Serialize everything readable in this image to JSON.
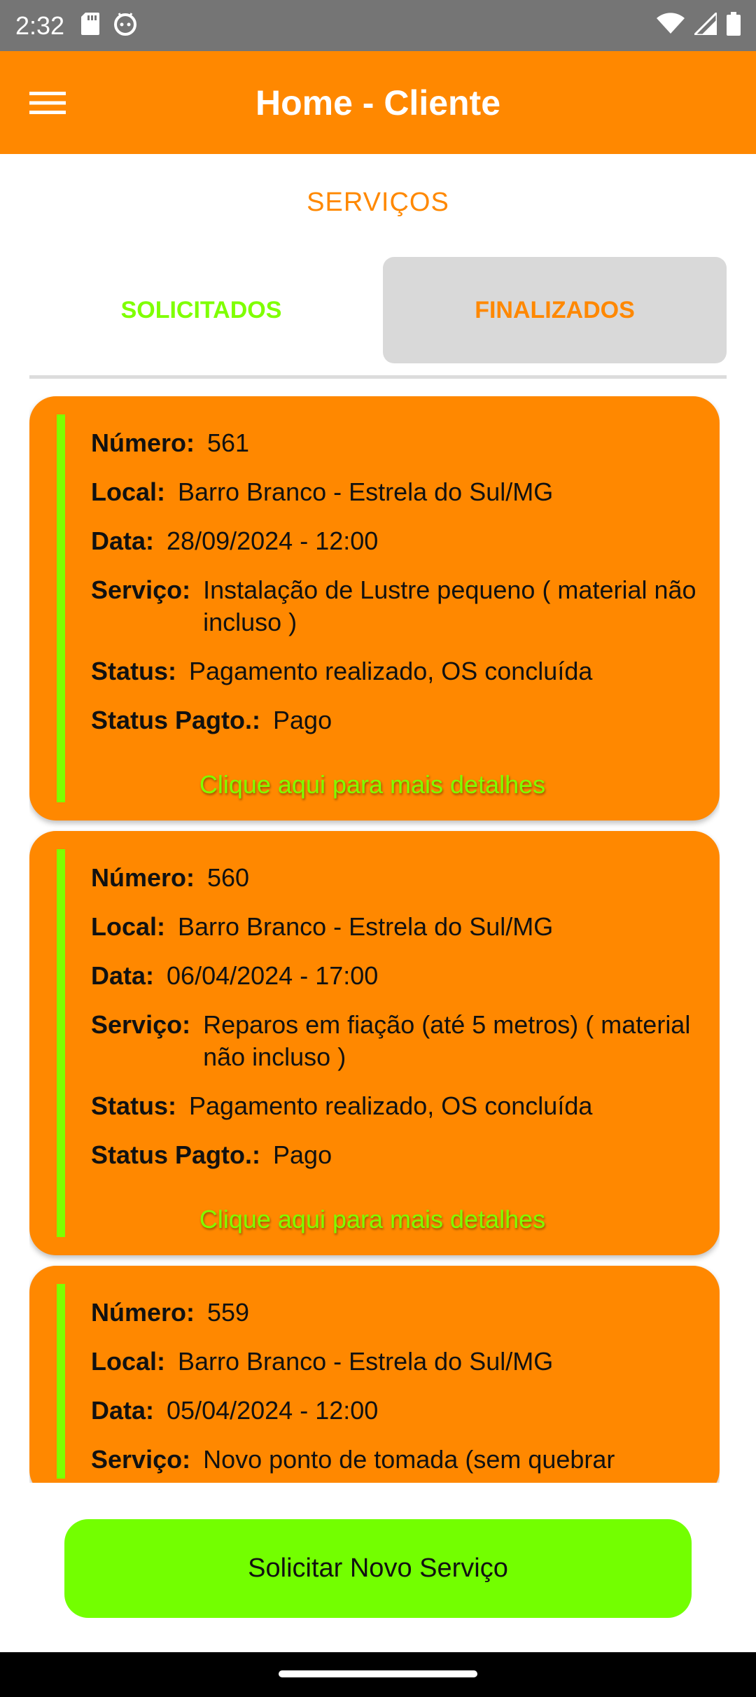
{
  "status_bar": {
    "time": "2:32",
    "icons_left": [
      "sd-card-icon",
      "android-debug-icon"
    ],
    "icons_right": [
      "wifi-icon",
      "signal-icon",
      "battery-icon"
    ]
  },
  "app_bar": {
    "title": "Home - Cliente",
    "menu_icon": "hamburger-menu-icon"
  },
  "section_title": "SERVIÇOS",
  "tabs": [
    {
      "label": "SOLICITADOS",
      "selected": false
    },
    {
      "label": "FINALIZADOS",
      "selected": true
    }
  ],
  "labels": {
    "numero": "Número:",
    "local": "Local:",
    "data": "Data:",
    "servico": "Serviço:",
    "status": "Status:",
    "status_pagto": "Status Pagto.:"
  },
  "cards": [
    {
      "numero": "561",
      "local": "Barro Branco  - Estrela do Sul/MG",
      "data": "28/09/2024 - 12:00",
      "servico": "Instalação de Lustre pequeno ( material não incluso )",
      "status": "Pagamento realizado, OS concluída",
      "status_pagto": "Pago",
      "link": "Clique aqui para mais detalhes"
    },
    {
      "numero": "560",
      "local": "Barro Branco  - Estrela do Sul/MG",
      "data": "06/04/2024 - 17:00",
      "servico": "Reparos em fiação (até 5 metros) ( material não incluso )",
      "status": "Pagamento realizado, OS concluída",
      "status_pagto": "Pago",
      "link": "Clique aqui para mais detalhes"
    },
    {
      "numero": "559",
      "local": "Barro Branco  - Estrela do Sul/MG",
      "data": "05/04/2024 - 12:00",
      "servico": "Novo ponto de tomada (sem quebrar",
      "status": "",
      "status_pagto": "",
      "link": ""
    }
  ],
  "bottom_button": "Solicitar Novo Serviço",
  "colors": {
    "primary": "#ff8800",
    "accent": "#7fff00",
    "status_bar": "#757575"
  }
}
